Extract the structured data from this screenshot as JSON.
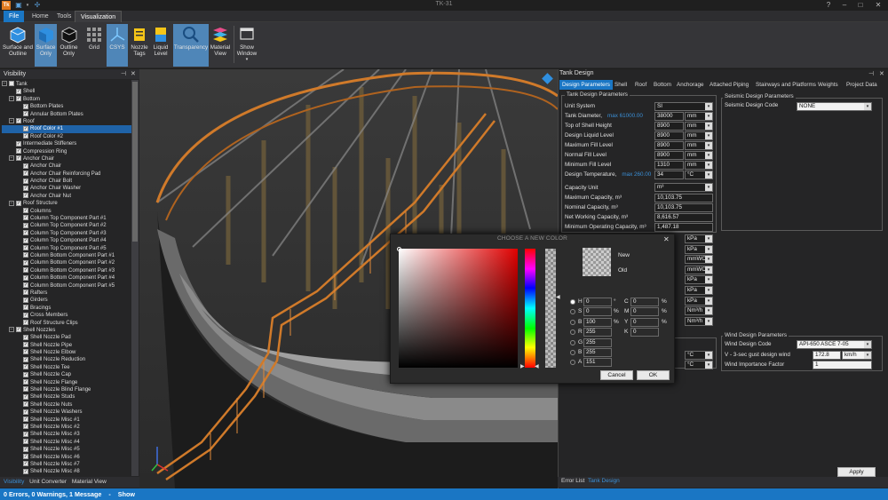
{
  "app": {
    "title": "TK-31",
    "help": "?"
  },
  "menu": {
    "file": "File",
    "home": "Home",
    "tools": "Tools",
    "visualization": "Visualization"
  },
  "ribbon": [
    {
      "label": "Surface and Outline",
      "icon": "surface-outline-icon"
    },
    {
      "label": "Surface Only",
      "icon": "surface-only-icon",
      "selected": true
    },
    {
      "label": "Outline Only",
      "icon": "outline-only-icon"
    },
    {
      "label": "Grid",
      "icon": "grid-icon"
    },
    {
      "label": "CSYS",
      "icon": "csys-icon",
      "selected": true
    },
    {
      "label": "Nozzle Tags",
      "icon": "nozzle-tags-icon"
    },
    {
      "label": "Liquid Level",
      "icon": "liquid-level-icon"
    },
    {
      "label": "Transparency",
      "icon": "transparency-icon",
      "selected": true
    },
    {
      "label": "Material View",
      "icon": "material-view-icon"
    },
    {
      "label": "Show Window",
      "icon": "show-window-icon"
    }
  ],
  "visibility": {
    "title": "Visibility",
    "tree": [
      {
        "label": "Tank",
        "level": 0,
        "expander": "⊟",
        "check": false
      },
      {
        "label": "Shell",
        "level": 1,
        "expander": "",
        "check": true
      },
      {
        "label": "Bottom",
        "level": 1,
        "expander": "⊟",
        "check": true
      },
      {
        "label": "Bottom Plates",
        "level": 2,
        "expander": "",
        "check": true
      },
      {
        "label": "Annular Bottom Plates",
        "level": 2,
        "expander": "",
        "check": true
      },
      {
        "label": "Roof",
        "level": 1,
        "expander": "⊟",
        "check": true
      },
      {
        "label": "Roof Color #1",
        "level": 2,
        "expander": "",
        "check": true,
        "selected": true
      },
      {
        "label": "Roof Color #2",
        "level": 2,
        "expander": "",
        "check": true
      },
      {
        "label": "Intermediate Stiffeners",
        "level": 1,
        "expander": "",
        "check": true
      },
      {
        "label": "Compression Ring",
        "level": 1,
        "expander": "",
        "check": true
      },
      {
        "label": "Anchor Chair",
        "level": 1,
        "expander": "⊟",
        "check": true
      },
      {
        "label": "Anchor Chair",
        "level": 2,
        "expander": "",
        "check": true
      },
      {
        "label": "Anchor Chair Reinforcing Pad",
        "level": 2,
        "expander": "",
        "check": true
      },
      {
        "label": "Anchor Chair Bolt",
        "level": 2,
        "expander": "",
        "check": true
      },
      {
        "label": "Anchor Chair Washer",
        "level": 2,
        "expander": "",
        "check": true
      },
      {
        "label": "Anchor Chair Nut",
        "level": 2,
        "expander": "",
        "check": true
      },
      {
        "label": "Roof Structure",
        "level": 1,
        "expander": "⊟",
        "check": true
      },
      {
        "label": "Columns",
        "level": 2,
        "expander": "",
        "check": true
      },
      {
        "label": "Column Top Component Part #1",
        "level": 2,
        "expander": "",
        "check": true
      },
      {
        "label": "Column Top Component Part #2",
        "level": 2,
        "expander": "",
        "check": true
      },
      {
        "label": "Column Top Component Part #3",
        "level": 2,
        "expander": "",
        "check": true
      },
      {
        "label": "Column Top Component Part #4",
        "level": 2,
        "expander": "",
        "check": true
      },
      {
        "label": "Column Top Component Part #5",
        "level": 2,
        "expander": "",
        "check": true
      },
      {
        "label": "Column Bottom Component Part #1",
        "level": 2,
        "expander": "",
        "check": true
      },
      {
        "label": "Column Bottom Component Part #2",
        "level": 2,
        "expander": "",
        "check": true
      },
      {
        "label": "Column Bottom Component Part #3",
        "level": 2,
        "expander": "",
        "check": true
      },
      {
        "label": "Column Bottom Component Part #4",
        "level": 2,
        "expander": "",
        "check": true
      },
      {
        "label": "Column Bottom Component Part #5",
        "level": 2,
        "expander": "",
        "check": true
      },
      {
        "label": "Rafters",
        "level": 2,
        "expander": "",
        "check": true
      },
      {
        "label": "Girders",
        "level": 2,
        "expander": "",
        "check": true
      },
      {
        "label": "Bracings",
        "level": 2,
        "expander": "",
        "check": true
      },
      {
        "label": "Cross Members",
        "level": 2,
        "expander": "",
        "check": true
      },
      {
        "label": "Roof Structure Clips",
        "level": 2,
        "expander": "",
        "check": true
      },
      {
        "label": "Shell Nozzles",
        "level": 1,
        "expander": "⊟",
        "check": true
      },
      {
        "label": "Shell Nozzle Pad",
        "level": 2,
        "expander": "",
        "check": true
      },
      {
        "label": "Shell Nozzle Pipe",
        "level": 2,
        "expander": "",
        "check": true
      },
      {
        "label": "Shell Nozzle Elbow",
        "level": 2,
        "expander": "",
        "check": true
      },
      {
        "label": "Shell Nozzle Reduction",
        "level": 2,
        "expander": "",
        "check": true
      },
      {
        "label": "Shell Nozzle Tee",
        "level": 2,
        "expander": "",
        "check": true
      },
      {
        "label": "Shell Nozzle Cap",
        "level": 2,
        "expander": "",
        "check": true
      },
      {
        "label": "Shell Nozzle Flange",
        "level": 2,
        "expander": "",
        "check": true
      },
      {
        "label": "Shell Nozzle Blind Flange",
        "level": 2,
        "expander": "",
        "check": true
      },
      {
        "label": "Shell Nozzle Studs",
        "level": 2,
        "expander": "",
        "check": true
      },
      {
        "label": "Shell Nozzle Nuts",
        "level": 2,
        "expander": "",
        "check": true
      },
      {
        "label": "Shell Nozzle Washers",
        "level": 2,
        "expander": "",
        "check": true
      },
      {
        "label": "Shell Nozzle Misc #1",
        "level": 2,
        "expander": "",
        "check": true
      },
      {
        "label": "Shell Nozzle Misc #2",
        "level": 2,
        "expander": "",
        "check": true
      },
      {
        "label": "Shell Nozzle Misc #3",
        "level": 2,
        "expander": "",
        "check": true
      },
      {
        "label": "Shell Nozzle Misc #4",
        "level": 2,
        "expander": "",
        "check": true
      },
      {
        "label": "Shell Nozzle Misc #5",
        "level": 2,
        "expander": "",
        "check": true
      },
      {
        "label": "Shell Nozzle Misc #6",
        "level": 2,
        "expander": "",
        "check": true
      },
      {
        "label": "Shell Nozzle Misc #7",
        "level": 2,
        "expander": "",
        "check": true
      },
      {
        "label": "Shell Nozzle Misc #8",
        "level": 2,
        "expander": "",
        "check": true
      }
    ],
    "bottom_tabs": [
      "Visibility",
      "Unit Converter",
      "Material View"
    ]
  },
  "tank_design": {
    "title": "Tank Design",
    "tabs": [
      "Design Parameters",
      "Shell",
      "Roof",
      "Bottom",
      "Anchorage",
      "Attached Piping",
      "Stairways and Platforms",
      "Weights",
      "Project Data"
    ],
    "group_title": "Tank Design Parameters",
    "unit_system": {
      "label": "Unit System",
      "value": "SI"
    },
    "rows": [
      {
        "label": "Tank Diameter,",
        "hint": "max 61000.00",
        "value": "38000",
        "unit": "mm"
      },
      {
        "label": "Top of Shell Height",
        "hint": "",
        "value": "8900",
        "unit": "mm"
      },
      {
        "label": "Design Liquid Level",
        "hint": "",
        "value": "8900",
        "unit": "mm"
      },
      {
        "label": "Maximum Fill Level",
        "hint": "",
        "value": "8900",
        "unit": "mm"
      },
      {
        "label": "Normal Fill Level",
        "hint": "",
        "value": "8900",
        "unit": "mm"
      },
      {
        "label": "Minimum Fill Level",
        "hint": "",
        "value": "1310",
        "unit": "mm"
      },
      {
        "label": "Design Temperature,",
        "hint": "max 260.00",
        "value": "34",
        "unit": "°C"
      }
    ],
    "capacity_unit": {
      "label": "Capacity Unit",
      "value": "m³"
    },
    "capacity_rows": [
      {
        "label": "Maximum Capacity, m³",
        "value": "10,103.75"
      },
      {
        "label": "Nominal Capacity, m³",
        "value": "10,103.75"
      },
      {
        "label": "Net Working Capacity, m³",
        "value": "8,616.57"
      },
      {
        "label": "Minimum Operating Capacity, m³",
        "value": "1,487.18"
      }
    ],
    "hidden_units": [
      "kPa",
      "kPa",
      "mmWC",
      "mmWC",
      "kPa",
      "kPa",
      "kPa",
      "Nm³/h",
      "Nm³/h"
    ],
    "lower_units": [
      "°C",
      "°C"
    ],
    "seismic": {
      "title": "Seismic Design Parameters",
      "label": "Seismic Design Code",
      "value": "NONE"
    },
    "wind": {
      "title": "Wind Design Parameters",
      "code_label": "Wind Design Code",
      "code_value": "API-650 ASCE 7-05",
      "speed_label": "V - 3-sec gust design wind",
      "speed_value": "172.8",
      "speed_unit": "km/h",
      "factor_label": "Wind Importance Factor",
      "factor_value": "1"
    },
    "apply": "Apply",
    "bottom_tabs": [
      "Error List",
      "Tank Design"
    ]
  },
  "color_dialog": {
    "title": "CHOOSE A NEW COLOR",
    "new_label": "New",
    "old_label": "Old",
    "fields_left": [
      {
        "k": "H",
        "v": "0",
        "unit": "°",
        "on": true
      },
      {
        "k": "S",
        "v": "0",
        "unit": "%",
        "on": false
      },
      {
        "k": "B",
        "v": "100",
        "unit": "%",
        "on": false
      },
      {
        "k": "R",
        "v": "255",
        "unit": "",
        "on": false
      },
      {
        "k": "G",
        "v": "255",
        "unit": "",
        "on": false
      },
      {
        "k": "B",
        "v": "255",
        "unit": "",
        "on": false
      },
      {
        "k": "A",
        "v": "151",
        "unit": "",
        "on": false
      }
    ],
    "fields_right": [
      {
        "k": "C",
        "v": "0",
        "unit": "%"
      },
      {
        "k": "M",
        "v": "0",
        "unit": "%"
      },
      {
        "k": "Y",
        "v": "0",
        "unit": "%"
      },
      {
        "k": "K",
        "v": "0",
        "unit": ""
      }
    ],
    "cancel": "Cancel",
    "ok": "OK",
    "close": "✕"
  },
  "status": {
    "text": "0 Errors, 0 Warnings, 1 Message",
    "sep": "-",
    "show": "Show"
  },
  "colors": {
    "accent": "#1a76c4",
    "stair": "#d07a2a",
    "tree_select": "#1f63a8"
  }
}
